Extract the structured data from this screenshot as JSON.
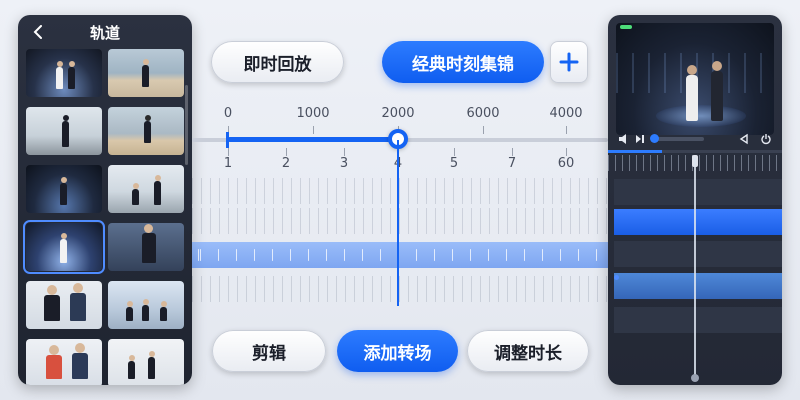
{
  "left_panel": {
    "title": "轨道",
    "back_icon": "chevron-left-icon",
    "thumbnails": [
      {
        "scene": "studio-couple"
      },
      {
        "scene": "beach-figure"
      },
      {
        "scene": "balcony-back"
      },
      {
        "scene": "beach-back"
      },
      {
        "scene": "studio-walk"
      },
      {
        "scene": "building-people"
      },
      {
        "scene": "studio-stage",
        "selected": true
      },
      {
        "scene": "tablet-man"
      },
      {
        "scene": "office-pair"
      },
      {
        "scene": "office-lobby"
      },
      {
        "scene": "office-couple"
      },
      {
        "scene": "office-workers"
      }
    ]
  },
  "top_buttons": {
    "instant_replay": "即时回放",
    "classic_moments": "经典时刻集锦",
    "add_icon": "plus-icon",
    "add_label": "+"
  },
  "ruler": {
    "top_labels": [
      "0",
      "1000",
      "2000",
      "6000",
      "4000"
    ],
    "bottom_labels": [
      "1",
      "2",
      "3",
      "4",
      "5",
      "7",
      "60"
    ],
    "knob_position_label": "2000"
  },
  "bottom_buttons": {
    "clip": "剪辑",
    "add_transition": "添加转场",
    "adjust_duration": "调整时长"
  },
  "right_panel": {
    "icons": [
      "volume-icon",
      "skip-icon",
      "rewind-icon",
      "power-icon"
    ],
    "status_color": "#4ddc7a"
  },
  "colors": {
    "accent": "#1463f3",
    "panel_bg": "#2b3140"
  }
}
